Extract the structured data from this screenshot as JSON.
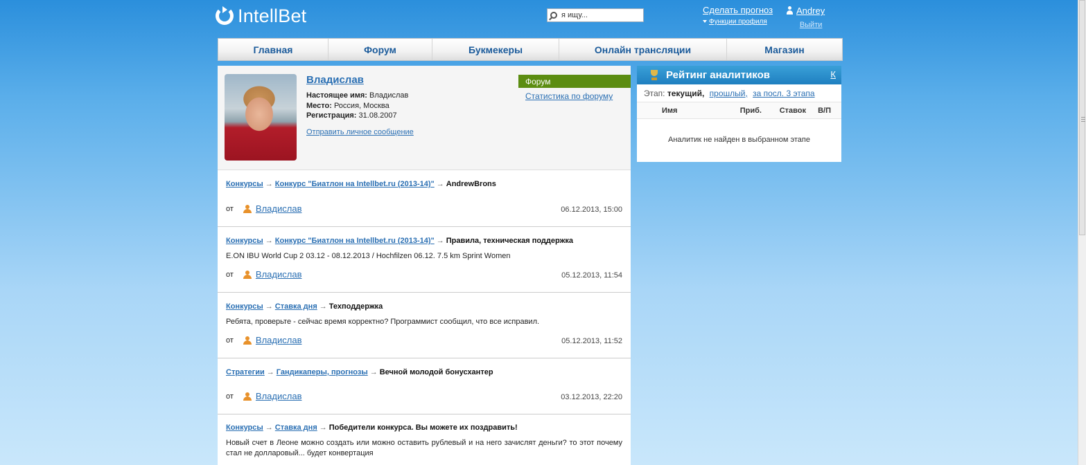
{
  "header": {
    "logo_text": "IntellBet",
    "search_placeholder": "я ищу...",
    "make_forecast": "Сделать прогноз",
    "profile_functions": "Функции профиля",
    "user_name": "Andrey",
    "logout": "Выйти"
  },
  "nav": {
    "items": [
      "Главная",
      "Форум",
      "Букмекеры",
      "Онлайн трансляции",
      "Магазин"
    ]
  },
  "profile": {
    "name": "Владислав",
    "real_name_label": "Настоящее имя:",
    "real_name": "Владислав",
    "place_label": "Место:",
    "place": "Россия, Москва",
    "registration_label": "Регистрация:",
    "registration": "31.08.2007",
    "send_message": "Отправить личное сообщение",
    "forum_tab": "Форум",
    "forum_stats": "Статистика по форуму"
  },
  "posts": [
    {
      "crumb1": "Конкурсы",
      "crumb2": "Конкурс \"Биатлон на Intellbet.ru (2013-14)\"",
      "topic": "AndrewBrons",
      "excerpt": "",
      "from_label": "от",
      "author": "Владислав",
      "date": "06.12.2013, 15:00"
    },
    {
      "crumb1": "Конкурсы",
      "crumb2": "Конкурс \"Биатлон на Intellbet.ru (2013-14)\"",
      "topic": "Правила, техническая поддержка",
      "excerpt": "E.ON IBU World Cup 2 03.12 - 08.12.2013 / Hochfilzen 06.12. 7.5 km Sprint Women",
      "from_label": "от",
      "author": "Владислав",
      "date": "05.12.2013, 11:54"
    },
    {
      "crumb1": "Конкурсы",
      "crumb2": "Ставка дня",
      "topic": "Техподдержка",
      "excerpt": "Ребята, проверьте - сейчас время корректно? Программист сообщил, что все исправил.",
      "from_label": "от",
      "author": "Владислав",
      "date": "05.12.2013, 11:52"
    },
    {
      "crumb1": "Стратегии",
      "crumb2": "Гандикаперы, прогнозы",
      "topic": "Вечной молодой бонусхантер",
      "excerpt": "",
      "from_label": "от",
      "author": "Владислав",
      "date": "03.12.2013, 22:20"
    },
    {
      "crumb1": "Конкурсы",
      "crumb2": "Ставка дня",
      "topic": "Победители конкурса. Вы можете их поздравить!",
      "excerpt": "Новый счет в Леоне можно создать или можно оставить рублевый и на него зачислят деньги? то этот почему стал не долларовый... будет конвертация",
      "from_label": "",
      "author": "",
      "date": ""
    }
  ],
  "rating": {
    "title": "Рейтинг аналитиков",
    "k_link": "К",
    "stage_label": "Этап:",
    "stage_current": "текущий,",
    "stage_past": "прошлый,",
    "stage_last3": "за посл. 3 этапа",
    "col_name": "Имя",
    "col_profit": "Приб.",
    "col_bets": "Ставок",
    "col_wl": "В/П",
    "empty": "Аналитик не найден в выбранном этапе"
  }
}
